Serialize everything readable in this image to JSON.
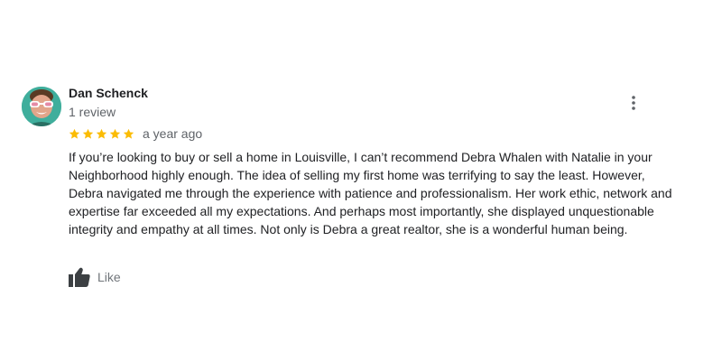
{
  "review": {
    "author_name": "Dan Schenck",
    "review_count": "1 review",
    "rating": 5,
    "rating_max": 5,
    "date": "a year ago",
    "text": "If you’re looking to buy or sell a home in Louisville, I can’t recommend Debra Whalen with Natalie in your Neighborhood highly enough. The idea of selling my first home was terrifying to say the least. However, Debra navigated me through the experience with patience and professionalism. Her work ethic, network and expertise far exceeded all my expectations. And perhaps most importantly, she displayed unquestionable integrity and empathy at all times. Not only is Debra a great realtor, she is a wonderful human being.",
    "like_label": "Like",
    "icons": {
      "menu": "more-vert-icon",
      "star": "star-icon",
      "like": "thumb-up-icon"
    },
    "colors": {
      "star": "#fbbc04",
      "secondary_text": "#5f6368",
      "like_icon": "#3c4043",
      "avatar_bg": "#3fae9c"
    }
  }
}
